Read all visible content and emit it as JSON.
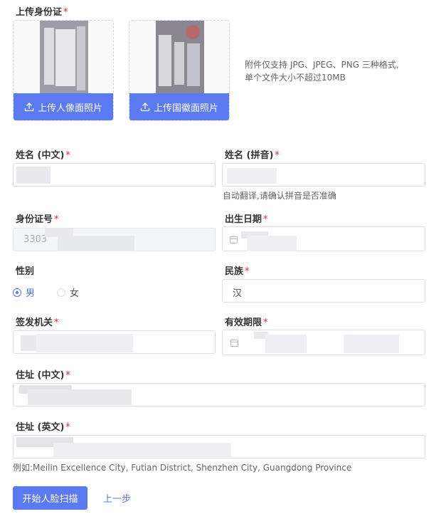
{
  "upload": {
    "label": "上传身份证",
    "required": "*",
    "front_button": "上传人像面照片",
    "back_button": "上传国徽面照片",
    "note_line1": "附件仅支持 JPG、JPEG、PNG 三种格式,",
    "note_line2": "单个文件大小不超过10MB"
  },
  "fields": {
    "name_cn": {
      "label": "姓名 (中文)",
      "required": "*"
    },
    "name_pinyin": {
      "label": "姓名 (拼音)",
      "required": "*",
      "hint": "自动翻译,请确认拼音是否准确"
    },
    "id_number": {
      "label": "身份证号",
      "required": "*",
      "value": "3303"
    },
    "birth_date": {
      "label": "出生日期",
      "required": "*"
    },
    "gender": {
      "label": "性别",
      "options": [
        "男",
        "女"
      ],
      "selected": "男"
    },
    "ethnicity": {
      "label": "民族",
      "required": "*",
      "value": "汉"
    },
    "issuing_authority": {
      "label": "签发机关",
      "required": "*"
    },
    "validity": {
      "label": "有效期限",
      "required": "*"
    },
    "address_cn": {
      "label": "住址 (中文)",
      "required": "*"
    },
    "address_en": {
      "label": "住址 (英文)",
      "required": "*",
      "hint": "例如:Meilin Excellence City, Futian District, Shenzhen City, Guangdong Province"
    }
  },
  "actions": {
    "start_scan": "开始人脸扫描",
    "back": "上一步"
  },
  "colors": {
    "primary": "#5b7af2",
    "required": "#f5222d"
  }
}
